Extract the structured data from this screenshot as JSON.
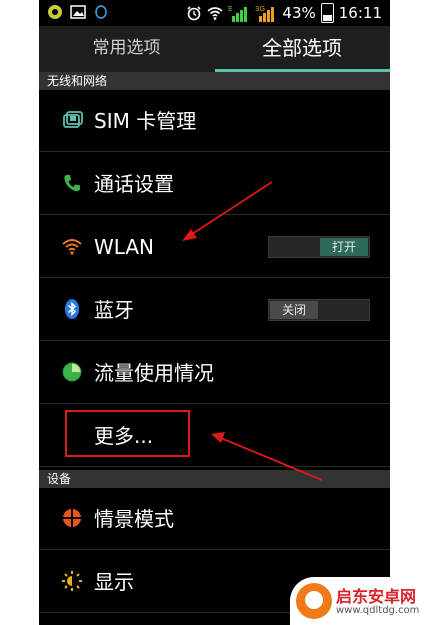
{
  "status_bar": {
    "battery_percent": "43%",
    "time": "16:11",
    "signal_tag_1": "E",
    "signal_tag_2": "3G"
  },
  "tabs": [
    {
      "label": "常用选项",
      "selected": false
    },
    {
      "label": "全部选项",
      "selected": true
    }
  ],
  "sections": {
    "wireless": "无线和网络",
    "device": "设备"
  },
  "rows": {
    "sim": {
      "label": "SIM 卡管理",
      "icon": "sim-card-icon"
    },
    "call": {
      "label": "通话设置",
      "icon": "phone-icon"
    },
    "wlan": {
      "label": "WLAN",
      "icon": "wifi-icon",
      "toggle": "打开",
      "on": true
    },
    "bluetooth": {
      "label": "蓝牙",
      "icon": "bluetooth-icon",
      "toggle": "关闭",
      "on": false
    },
    "data_usage": {
      "label": "流量使用情况",
      "icon": "pie-chart-icon"
    },
    "more": {
      "label": "更多..."
    },
    "profiles": {
      "label": "情景模式",
      "icon": "profile-icon"
    },
    "display": {
      "label": "显示",
      "icon": "brightness-icon"
    }
  },
  "colors": {
    "accent": "#5fbfae",
    "annotation_red": "#e01818"
  },
  "watermark": {
    "title": "启东安卓网",
    "url": "www.qdltdg.com"
  }
}
